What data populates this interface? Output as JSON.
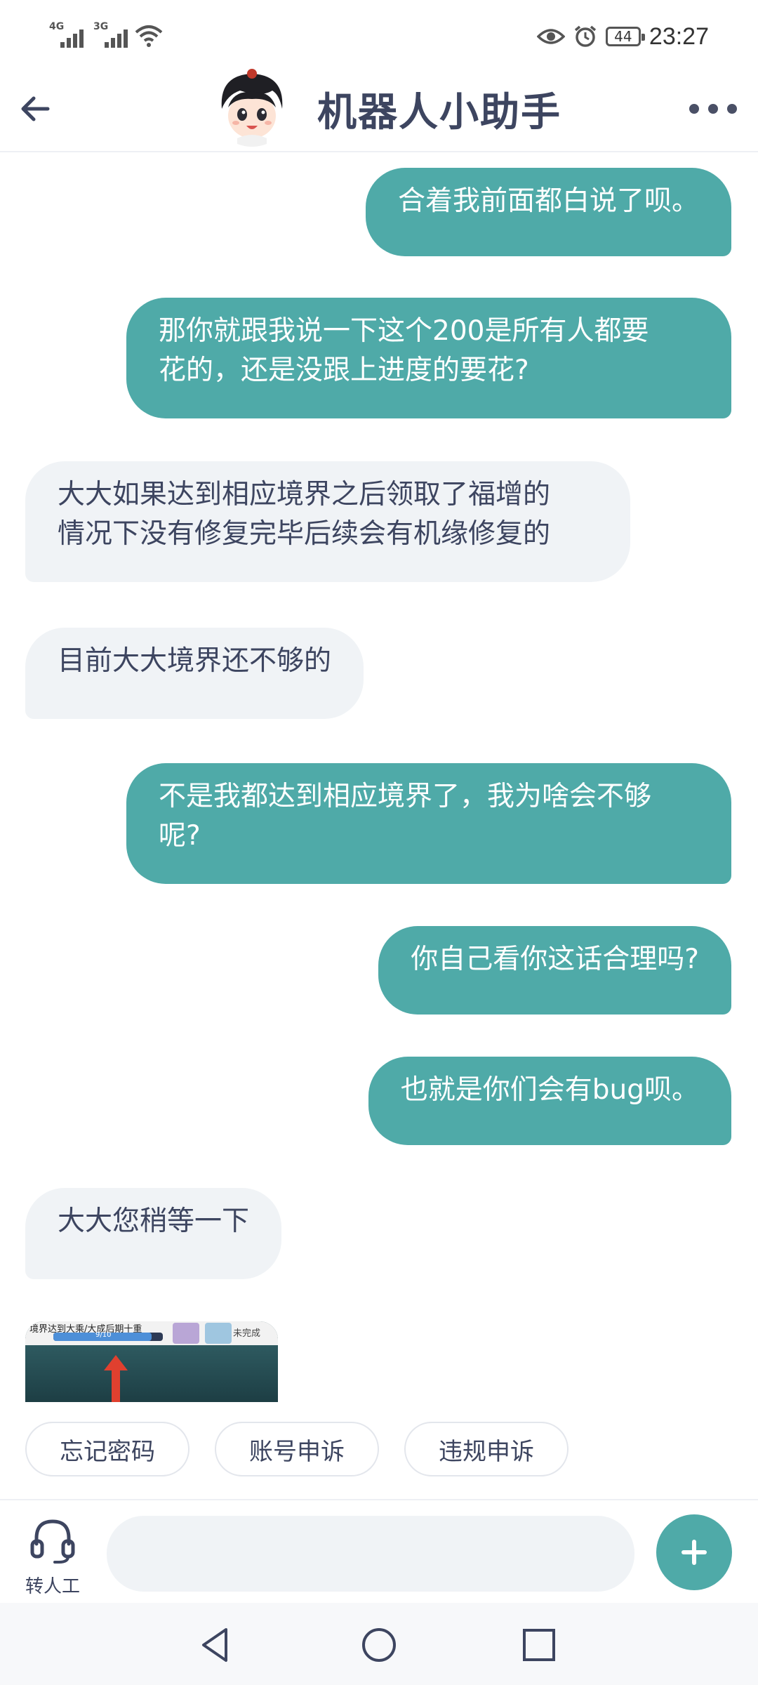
{
  "status_bar": {
    "signal1_type": "4G",
    "signal2_type": "3G",
    "battery": "44",
    "time": "23:27"
  },
  "header": {
    "title": "机器人小助手"
  },
  "messages": [
    {
      "side": "out",
      "text": "合着我前面都白说了呗。"
    },
    {
      "side": "out",
      "text": "那你就跟我说一下这个200是所有人都要\n花的，还是没跟上进度的要花?"
    },
    {
      "side": "in",
      "text": "大大如果达到相应境界之后领取了福增的\n情况下没有修复完毕后续会有机缘修复的"
    },
    {
      "side": "in",
      "text": "目前大大境界还不够的"
    },
    {
      "side": "out",
      "text": "不是我都达到相应境界了，我为啥会不够\n呢?"
    },
    {
      "side": "out",
      "text": "你自己看你这话合理吗?"
    },
    {
      "side": "out",
      "text": "也就是你们会有bug呗。"
    },
    {
      "side": "in",
      "text": "大大您稍等一下"
    }
  ],
  "image_card": {
    "caption": "境界达到大乘/大成后期十重",
    "progress_text": "9/10",
    "progress": 0.9,
    "status": "未完成"
  },
  "quick_replies": [
    "忘记密码",
    "账号申诉",
    "违规申诉"
  ],
  "input_bar": {
    "human_label": "转人工",
    "placeholder": ""
  },
  "colors": {
    "accent": "#4faaa8",
    "incoming_bubble": "#f0f3f6",
    "text": "#3d4560"
  }
}
